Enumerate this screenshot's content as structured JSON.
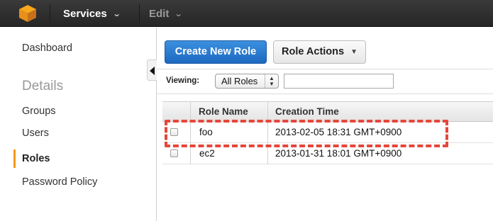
{
  "topbar": {
    "logo_icon": "aws-cube-icon",
    "services_label": "Services",
    "edit_label": "Edit"
  },
  "sidebar": {
    "items": [
      {
        "label": "Dashboard"
      },
      {
        "label": "Details",
        "heading": true
      },
      {
        "label": "Groups"
      },
      {
        "label": "Users"
      },
      {
        "label": "Roles",
        "active": true
      },
      {
        "label": "Password Policy"
      }
    ],
    "accent_color": "#f49a1a"
  },
  "toolbar": {
    "create_label": "Create New Role",
    "actions_label": "Role Actions",
    "primary_color": "#2a7bd1"
  },
  "filter": {
    "viewing_label": "Viewing:",
    "select_value": "All Roles",
    "search_value": ""
  },
  "table": {
    "columns": [
      "Role Name",
      "Creation Time"
    ],
    "rows": [
      {
        "name": "foo",
        "created": "2013-02-05 18:31 GMT+0900",
        "highlighted": true
      },
      {
        "name": "ec2",
        "created": "2013-01-31 18:01 GMT+0900",
        "highlighted": false
      }
    ]
  },
  "annotation": {
    "highlight_color": "#e4473b"
  }
}
